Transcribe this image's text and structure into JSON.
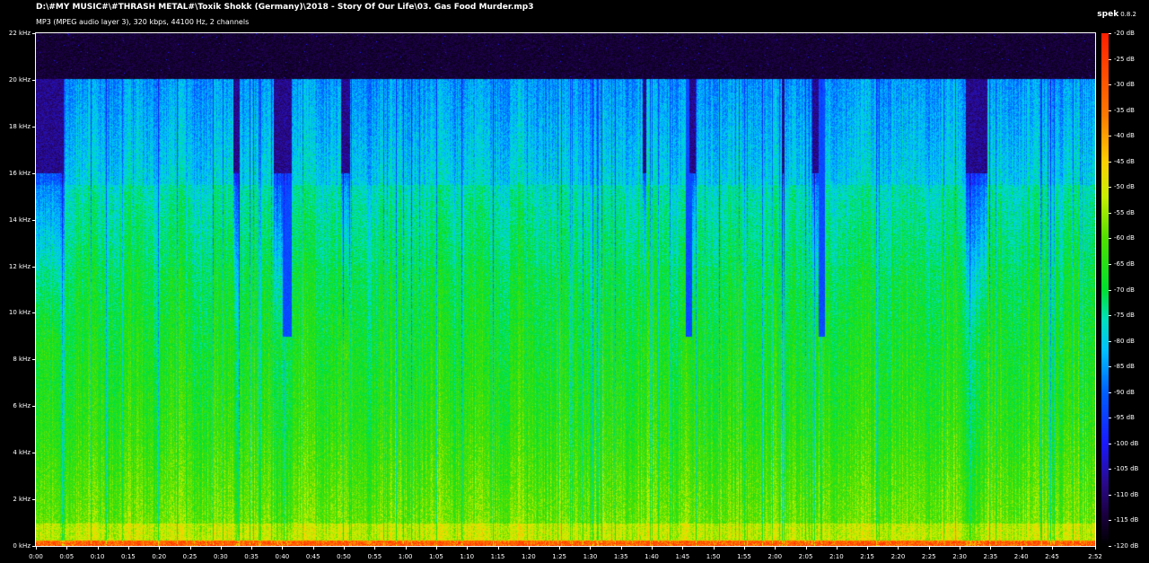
{
  "file_path": "D:\\#MY MUSIC#\\#THRASH METAL#\\Toxik Shokk (Germany)\\2018 - Story Of Our Life\\03. Gas Food Murder.mp3",
  "stream_info": "MP3 (MPEG audio layer 3), 320 kbps, 44100 Hz, 2 channels",
  "app": {
    "name": "spek",
    "version": "0.8.2"
  },
  "freq_axis": {
    "labels": [
      "22 kHz",
      "20 kHz",
      "18 kHz",
      "16 kHz",
      "14 kHz",
      "12 kHz",
      "10 kHz",
      "8 kHz",
      "6 kHz",
      "4 kHz",
      "2 kHz",
      "0 kHz"
    ],
    "values_khz": [
      22,
      20,
      18,
      16,
      14,
      12,
      10,
      8,
      6,
      4,
      2,
      0
    ]
  },
  "time_axis": {
    "labels": [
      "0:00",
      "0:05",
      "0:10",
      "0:15",
      "0:20",
      "0:25",
      "0:30",
      "0:35",
      "0:40",
      "0:45",
      "0:50",
      "0:55",
      "1:00",
      "1:05",
      "1:10",
      "1:15",
      "1:20",
      "1:25",
      "1:30",
      "1:35",
      "1:40",
      "1:45",
      "1:50",
      "1:55",
      "2:00",
      "2:05",
      "2:10",
      "2:15",
      "2:20",
      "2:25",
      "2:30",
      "2:35",
      "2:40",
      "2:45",
      "2:52"
    ],
    "values_sec": [
      0,
      5,
      10,
      15,
      20,
      25,
      30,
      35,
      40,
      45,
      50,
      55,
      60,
      65,
      70,
      75,
      80,
      85,
      90,
      95,
      100,
      105,
      110,
      115,
      120,
      125,
      130,
      135,
      140,
      145,
      150,
      155,
      160,
      165,
      172
    ],
    "duration_sec": 172
  },
  "db_scale": {
    "labels": [
      "-20 dB",
      "-25 dB",
      "-30 dB",
      "-35 dB",
      "-40 dB",
      "-45 dB",
      "-50 dB",
      "-55 dB",
      "-60 dB",
      "-65 dB",
      "-70 dB",
      "-75 dB",
      "-80 dB",
      "-85 dB",
      "-90 dB",
      "-95 dB",
      "-100 dB",
      "-105 dB",
      "-110 dB",
      "-115 dB",
      "-120 dB"
    ],
    "values_db": [
      -20,
      -25,
      -30,
      -35,
      -40,
      -45,
      -50,
      -55,
      -60,
      -65,
      -70,
      -75,
      -80,
      -85,
      -90,
      -95,
      -100,
      -105,
      -110,
      -115,
      -120
    ]
  },
  "spectrum": {
    "lowpass_cutoff_khz": 20,
    "gap_segments_sec": [
      [
        0,
        4.5
      ],
      [
        32,
        33
      ],
      [
        38.5,
        41.5
      ],
      [
        49.5,
        51
      ],
      [
        98.5,
        99
      ],
      [
        106,
        107
      ],
      [
        121,
        121.5
      ],
      [
        126,
        127
      ],
      [
        151,
        154.5
      ]
    ],
    "dark_dip_segments_sec": [
      [
        40,
        41.5
      ],
      [
        105.5,
        106.5
      ],
      [
        127,
        128
      ]
    ],
    "colors": {
      "background": "#000000",
      "frame": "#ffffff",
      "text": "#ffffff"
    },
    "palette_stops": [
      {
        "db": -120,
        "color": "#000000"
      },
      {
        "db": -114,
        "color": "#1a0040"
      },
      {
        "db": -108,
        "color": "#2a0a8a"
      },
      {
        "db": -100,
        "color": "#1a1aff"
      },
      {
        "db": -90,
        "color": "#0060ff"
      },
      {
        "db": -82,
        "color": "#00c0ff"
      },
      {
        "db": -76,
        "color": "#00e0c0"
      },
      {
        "db": -70,
        "color": "#00e030"
      },
      {
        "db": -60,
        "color": "#50e000"
      },
      {
        "db": -52,
        "color": "#c8f000"
      },
      {
        "db": -45,
        "color": "#ffd000"
      },
      {
        "db": -36,
        "color": "#ff7a00"
      },
      {
        "db": -20,
        "color": "#ff2000"
      }
    ]
  }
}
